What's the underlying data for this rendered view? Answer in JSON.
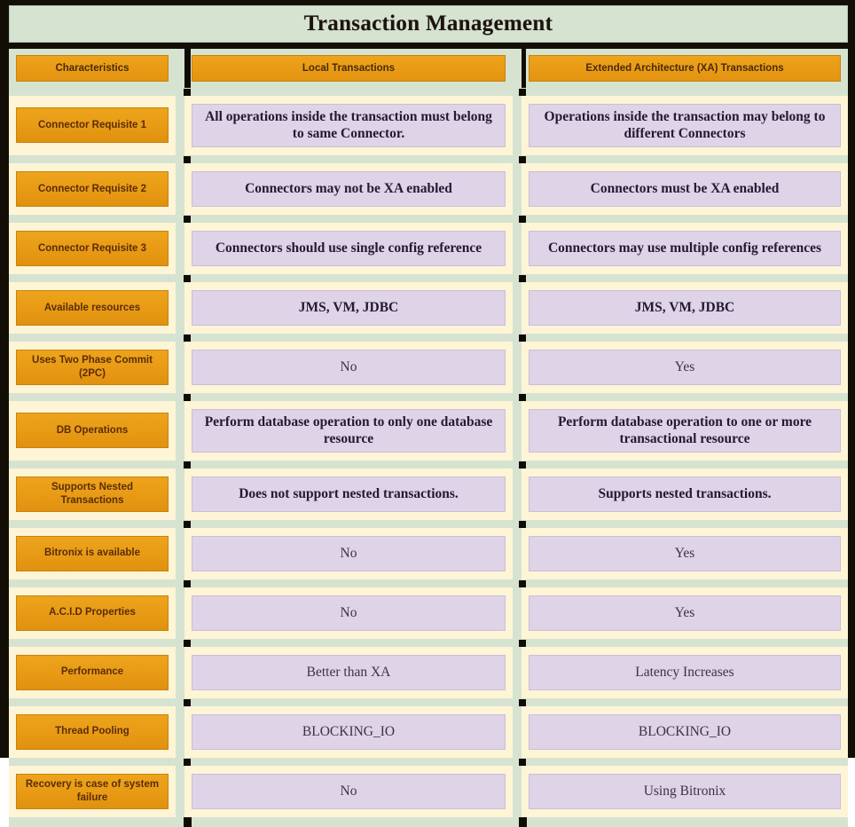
{
  "title": "Transaction Management",
  "columns": [
    {
      "key": "characteristic",
      "label": "Characteristics"
    },
    {
      "key": "local",
      "label": "Local Transactions"
    },
    {
      "key": "xa",
      "label": "Extended Architecture (XA) Transactions"
    }
  ],
  "rows": [
    {
      "characteristic": "Connector Requisite 1",
      "local": "All operations inside the transaction must belong to same Connector.",
      "xa": "Operations inside the transaction may belong to different Connectors",
      "emphasis": "strong"
    },
    {
      "characteristic": "Connector Requisite 2",
      "local": "Connectors may not be XA enabled",
      "xa": "Connectors must be XA enabled",
      "emphasis": "strong"
    },
    {
      "characteristic": "Connector Requisite 3",
      "local": "Connectors should use single config reference",
      "xa": "Connectors may use multiple config references",
      "emphasis": "strong"
    },
    {
      "characteristic": "Available resources",
      "local": "JMS, VM, JDBC",
      "xa": "JMS, VM, JDBC",
      "emphasis": "strong"
    },
    {
      "characteristic": "Uses Two Phase Commit (2PC)",
      "local": "No",
      "xa": "Yes",
      "emphasis": "light"
    },
    {
      "characteristic": "DB Operations",
      "local": "Perform database operation to only one database resource",
      "xa": "Perform database operation to one or more transactional resource",
      "emphasis": "strong"
    },
    {
      "characteristic": "Supports Nested Transactions",
      "local": "Does not support nested transactions.",
      "xa": "Supports nested transactions.",
      "emphasis": "strong"
    },
    {
      "characteristic": "Bitronix is available",
      "local": "No",
      "xa": "Yes",
      "emphasis": "light"
    },
    {
      "characteristic": "A.C.I.D Properties",
      "local": "No",
      "xa": "Yes",
      "emphasis": "light"
    },
    {
      "characteristic": "Performance",
      "local": "Better than XA",
      "xa": "Latency Increases",
      "emphasis": "light"
    },
    {
      "characteristic": "Thread Pooling",
      "local": "BLOCKING_IO",
      "xa": "BLOCKING_IO",
      "emphasis": "light"
    },
    {
      "characteristic": "Recovery is case of system failure",
      "local": "No",
      "xa": "Using Bitronix",
      "emphasis": "light"
    }
  ],
  "colors": {
    "frame": "#140f06",
    "title_band": "#d6e3d1",
    "chip": "#e89a15",
    "chip_text": "#5a2d06",
    "value_cell": "#ded3e7",
    "value_text": "#231a33",
    "row_background": "#fdf5d6"
  }
}
